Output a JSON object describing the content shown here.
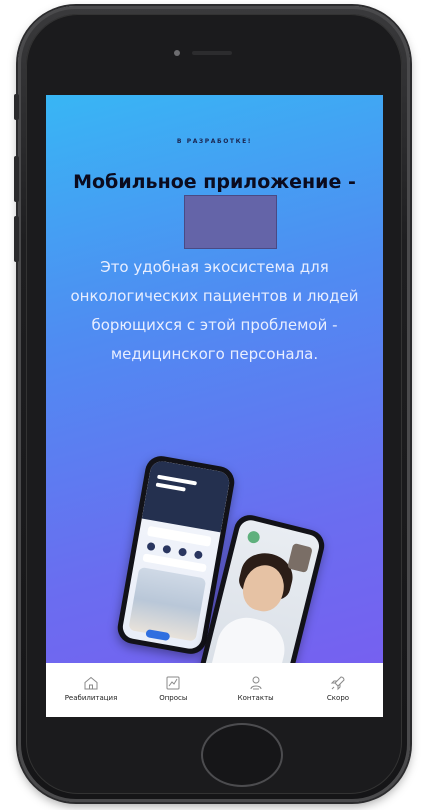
{
  "hero": {
    "eyebrow": "В РАЗРАБОТКЕ!",
    "headline": "Мобильное приложение -",
    "description": "Это удобная экосистема для онкологических пациентов и людей борющихся с этой проблемой - медицинского персонала."
  },
  "tabs": [
    {
      "label": "Реабилитация",
      "icon": "home-icon"
    },
    {
      "label": "Опросы",
      "icon": "chart-icon"
    },
    {
      "label": "Контакты",
      "icon": "person-icon"
    },
    {
      "label": "Скоро",
      "icon": "rocket-icon"
    }
  ],
  "colors": {
    "gradient_start": "#38b6f4",
    "gradient_end": "#7a5cf0",
    "redaction": "#6464a8"
  }
}
